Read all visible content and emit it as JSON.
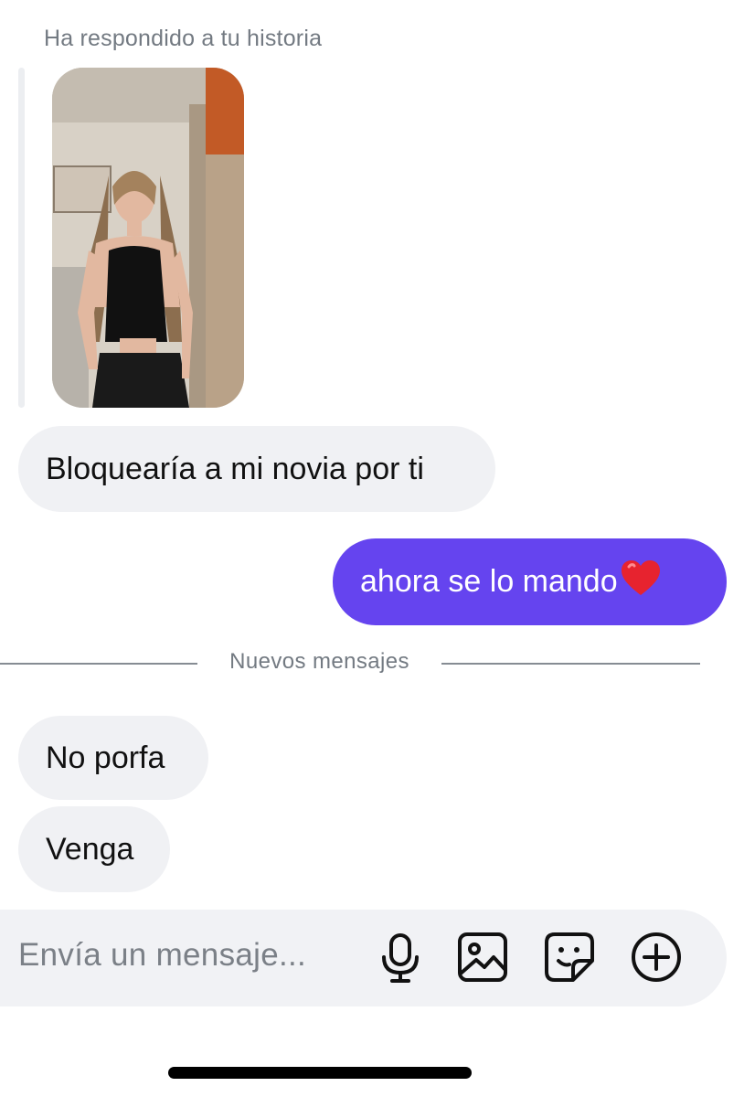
{
  "story_reply": {
    "caption": "Ha respondido a tu historia"
  },
  "messages": [
    {
      "direction": "incoming",
      "text": "Bloquearía a mi novia por ti"
    },
    {
      "direction": "outgoing",
      "text": "ahora se lo mando",
      "emoji": "heart"
    }
  ],
  "divider": {
    "label": "Nuevos mensajes"
  },
  "new_messages": [
    {
      "direction": "incoming",
      "text": "No porfa"
    },
    {
      "direction": "incoming",
      "text": "Venga"
    }
  ],
  "composer": {
    "placeholder": "Envía un mensaje...",
    "icons": [
      "microphone-icon",
      "image-icon",
      "sticker-icon",
      "plus-circle-icon"
    ]
  },
  "colors": {
    "outgoing_bubble": "#6544ef",
    "incoming_bubble": "#f0f1f4",
    "secondary_text": "#737a82"
  }
}
